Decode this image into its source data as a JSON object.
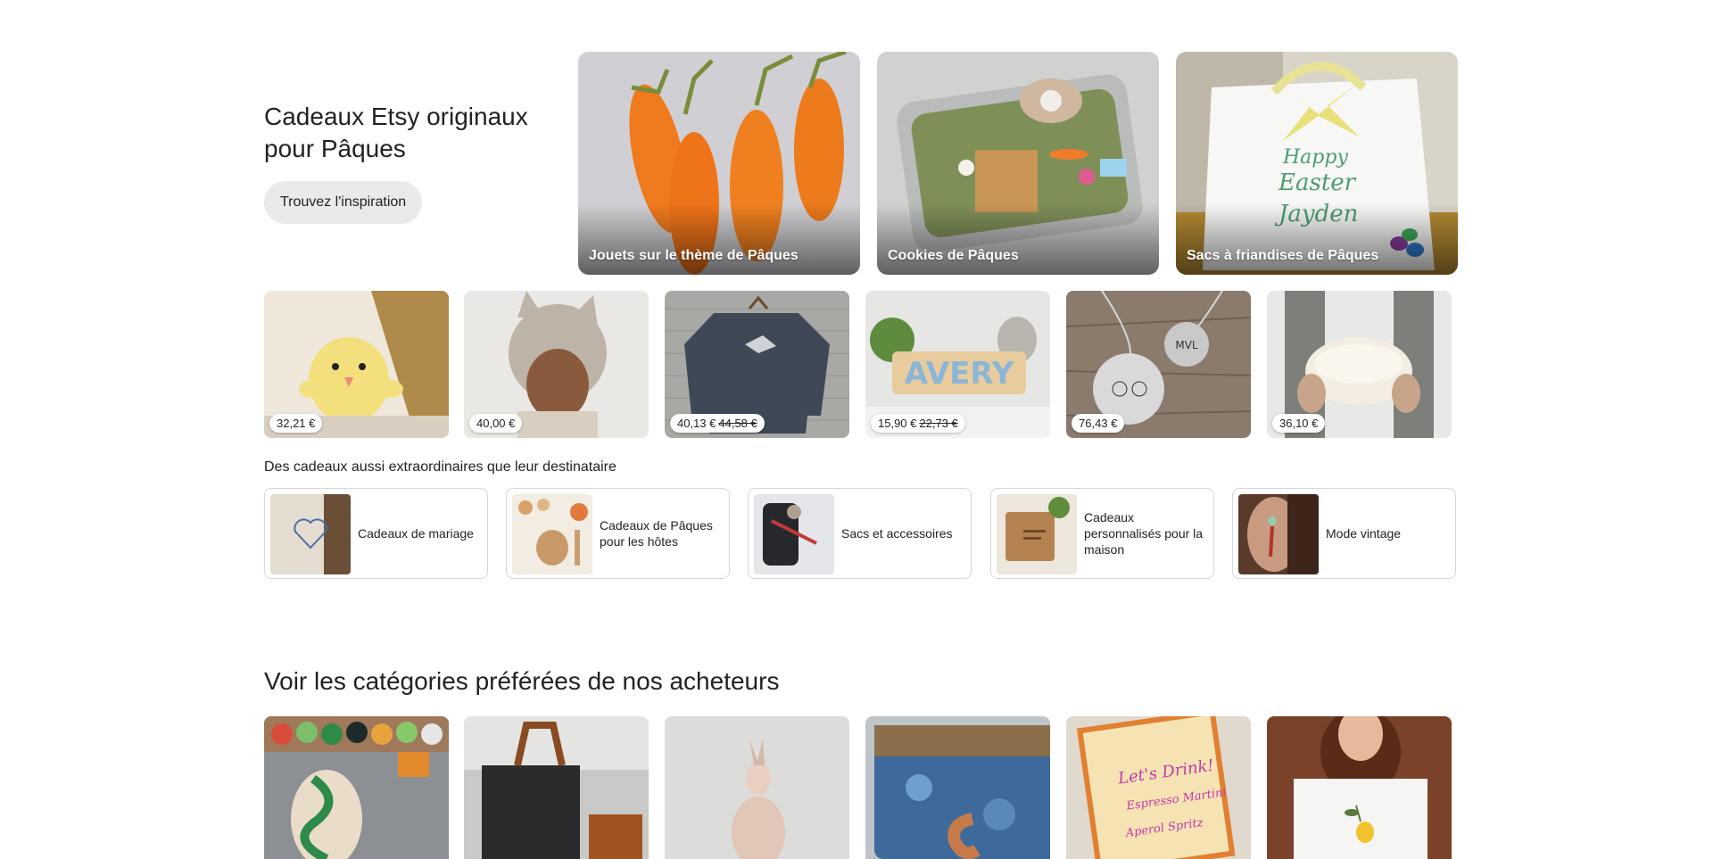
{
  "hero": {
    "title": "Cadeaux Etsy originaux pour Pâques",
    "button_label": "Trouvez l'inspiration",
    "cards": [
      {
        "label": "Jouets sur le thème de Pâques",
        "image": "felt-carrots"
      },
      {
        "label": "Cookies de Pâques",
        "image": "easter-tin-playset"
      },
      {
        "label": "Sacs à friandises de Pâques",
        "image": "easter-gift-bag"
      }
    ]
  },
  "products": [
    {
      "price": "32,21 €",
      "old_price": "",
      "image": "yellow-chick-plush"
    },
    {
      "price": "40,00 €",
      "old_price": "",
      "image": "child-knit-bonnet"
    },
    {
      "price": "40,13 €",
      "old_price": "44,58 €",
      "image": "grey-sweater-hanger"
    },
    {
      "price": "15,90 €",
      "old_price": "22,73 €",
      "image": "name-puzzle-avery"
    },
    {
      "price": "76,43 €",
      "old_price": "",
      "image": "bunny-charm-necklace"
    },
    {
      "price": "36,10 €",
      "old_price": "",
      "image": "ceramic-bowl"
    }
  ],
  "gifts": {
    "heading": "Des cadeaux aussi extraordinaires que leur destinataire",
    "items": [
      {
        "label": "Cadeaux de mariage",
        "image": "embroidered-heart"
      },
      {
        "label": "Cadeaux de Pâques pour les hôtes",
        "image": "easter-table"
      },
      {
        "label": "Sacs et accessoires",
        "image": "black-bag"
      },
      {
        "label": "Cadeaux personnalisés pour la maison",
        "image": "wood-cutting-board"
      },
      {
        "label": "Mode vintage",
        "image": "vintage-earring"
      }
    ]
  },
  "favorites": {
    "title": "Voir les catégories préférées de nos acheteurs",
    "items": [
      {
        "image": "embroidery-threads"
      },
      {
        "image": "leather-bag"
      },
      {
        "image": "soft-doll"
      },
      {
        "image": "blue-ceramic-mug"
      },
      {
        "image": "lets-drink-card"
      },
      {
        "image": "lemon-tshirt"
      }
    ]
  },
  "colors": {
    "text": "#222222",
    "button_bg": "#eaeaea",
    "border": "#d6d6d6"
  }
}
